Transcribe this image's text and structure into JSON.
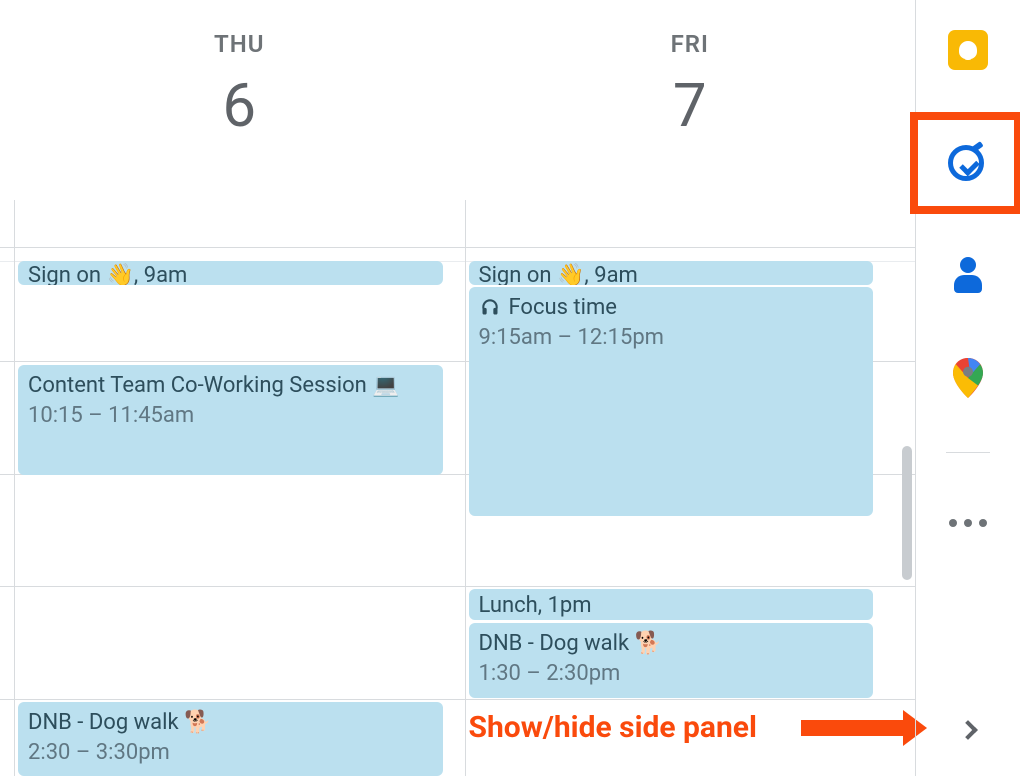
{
  "sidebar": {
    "keep_icon": "keep-icon",
    "tasks_icon": "tasks-icon",
    "contacts_icon": "contacts-icon",
    "maps_icon": "maps-icon",
    "more_icon": "more-dots-icon",
    "collapse_icon": "chevron-right-icon"
  },
  "annotation": {
    "label": "Show/hide side panel"
  },
  "columns": [
    {
      "weekday": "THU",
      "date": "6",
      "events": [
        {
          "id": "thu-signon",
          "title": "Sign on 👋, 9am",
          "time": ""
        },
        {
          "id": "thu-cowork",
          "title": "Content Team Co-Working Session 💻",
          "time": "10:15 – 11:45am"
        },
        {
          "id": "thu-dogwalk",
          "title": "DNB - Dog walk 🐕",
          "time": "2:30 – 3:30pm"
        }
      ]
    },
    {
      "weekday": "FRI",
      "date": "7",
      "events": [
        {
          "id": "fri-signon",
          "title": "Sign on 👋, 9am",
          "time": ""
        },
        {
          "id": "fri-focus",
          "title": "Focus time",
          "time": "9:15am – 12:15pm",
          "icon": "headphones-icon"
        },
        {
          "id": "fri-lunch",
          "title": "Lunch, 1pm",
          "time": ""
        },
        {
          "id": "fri-dogwalk",
          "title": "DNB - Dog walk 🐕",
          "time": "1:30 – 2:30pm"
        }
      ]
    }
  ]
}
